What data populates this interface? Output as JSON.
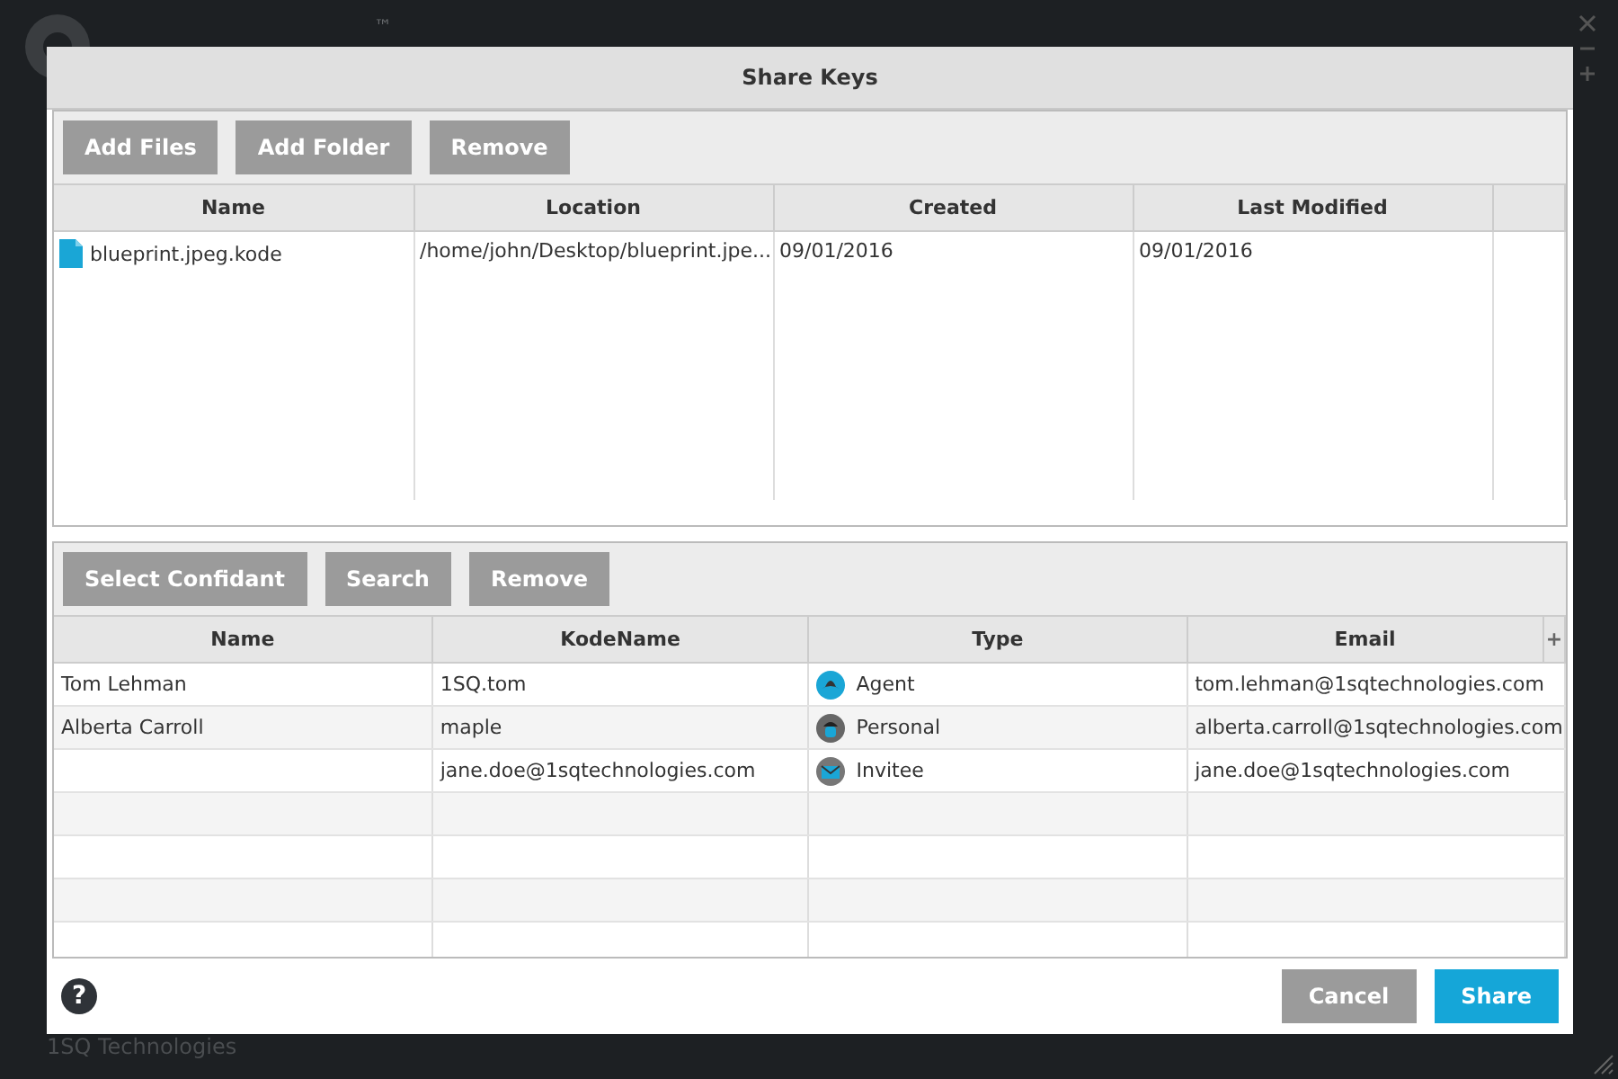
{
  "app": {
    "trademark": "™",
    "company": "1SQ Technologies"
  },
  "dialog": {
    "title": "Share Keys",
    "files_toolbar": [
      "Add Files",
      "Add Folder",
      "Remove"
    ],
    "files_table": {
      "columns": [
        "Name",
        "Location",
        "Created",
        "Last Modified"
      ],
      "rows": [
        {
          "name": "blueprint.jpeg.kode",
          "location": "/home/john/Desktop/blueprint.jpe...",
          "created": "09/01/2016",
          "modified": "09/01/2016"
        }
      ]
    },
    "confidants_toolbar": [
      "Select Confidant",
      "Search",
      "Remove"
    ],
    "confidants_table": {
      "columns": [
        "Name",
        "KodeName",
        "Type",
        "Email"
      ],
      "corner": "+",
      "rows": [
        {
          "name": "Tom Lehman",
          "kodename": "1SQ.tom",
          "type": "Agent",
          "kind": "agent",
          "email": "tom.lehman@1sqtechnologies.com"
        },
        {
          "name": "Alberta Carroll",
          "kodename": "maple",
          "type": "Personal",
          "kind": "personal",
          "email": "alberta.carroll@1sqtechnologies.com"
        },
        {
          "kodename": "jane.doe@1sqtechnologies.com",
          "type": "Invitee",
          "kind": "invitee",
          "email": "jane.doe@1sqtechnologies.com"
        }
      ]
    },
    "help": "?",
    "buttons": [
      {
        "label": "Cancel",
        "kind": "secondary"
      },
      {
        "label": "Share",
        "kind": "primary"
      }
    ]
  }
}
